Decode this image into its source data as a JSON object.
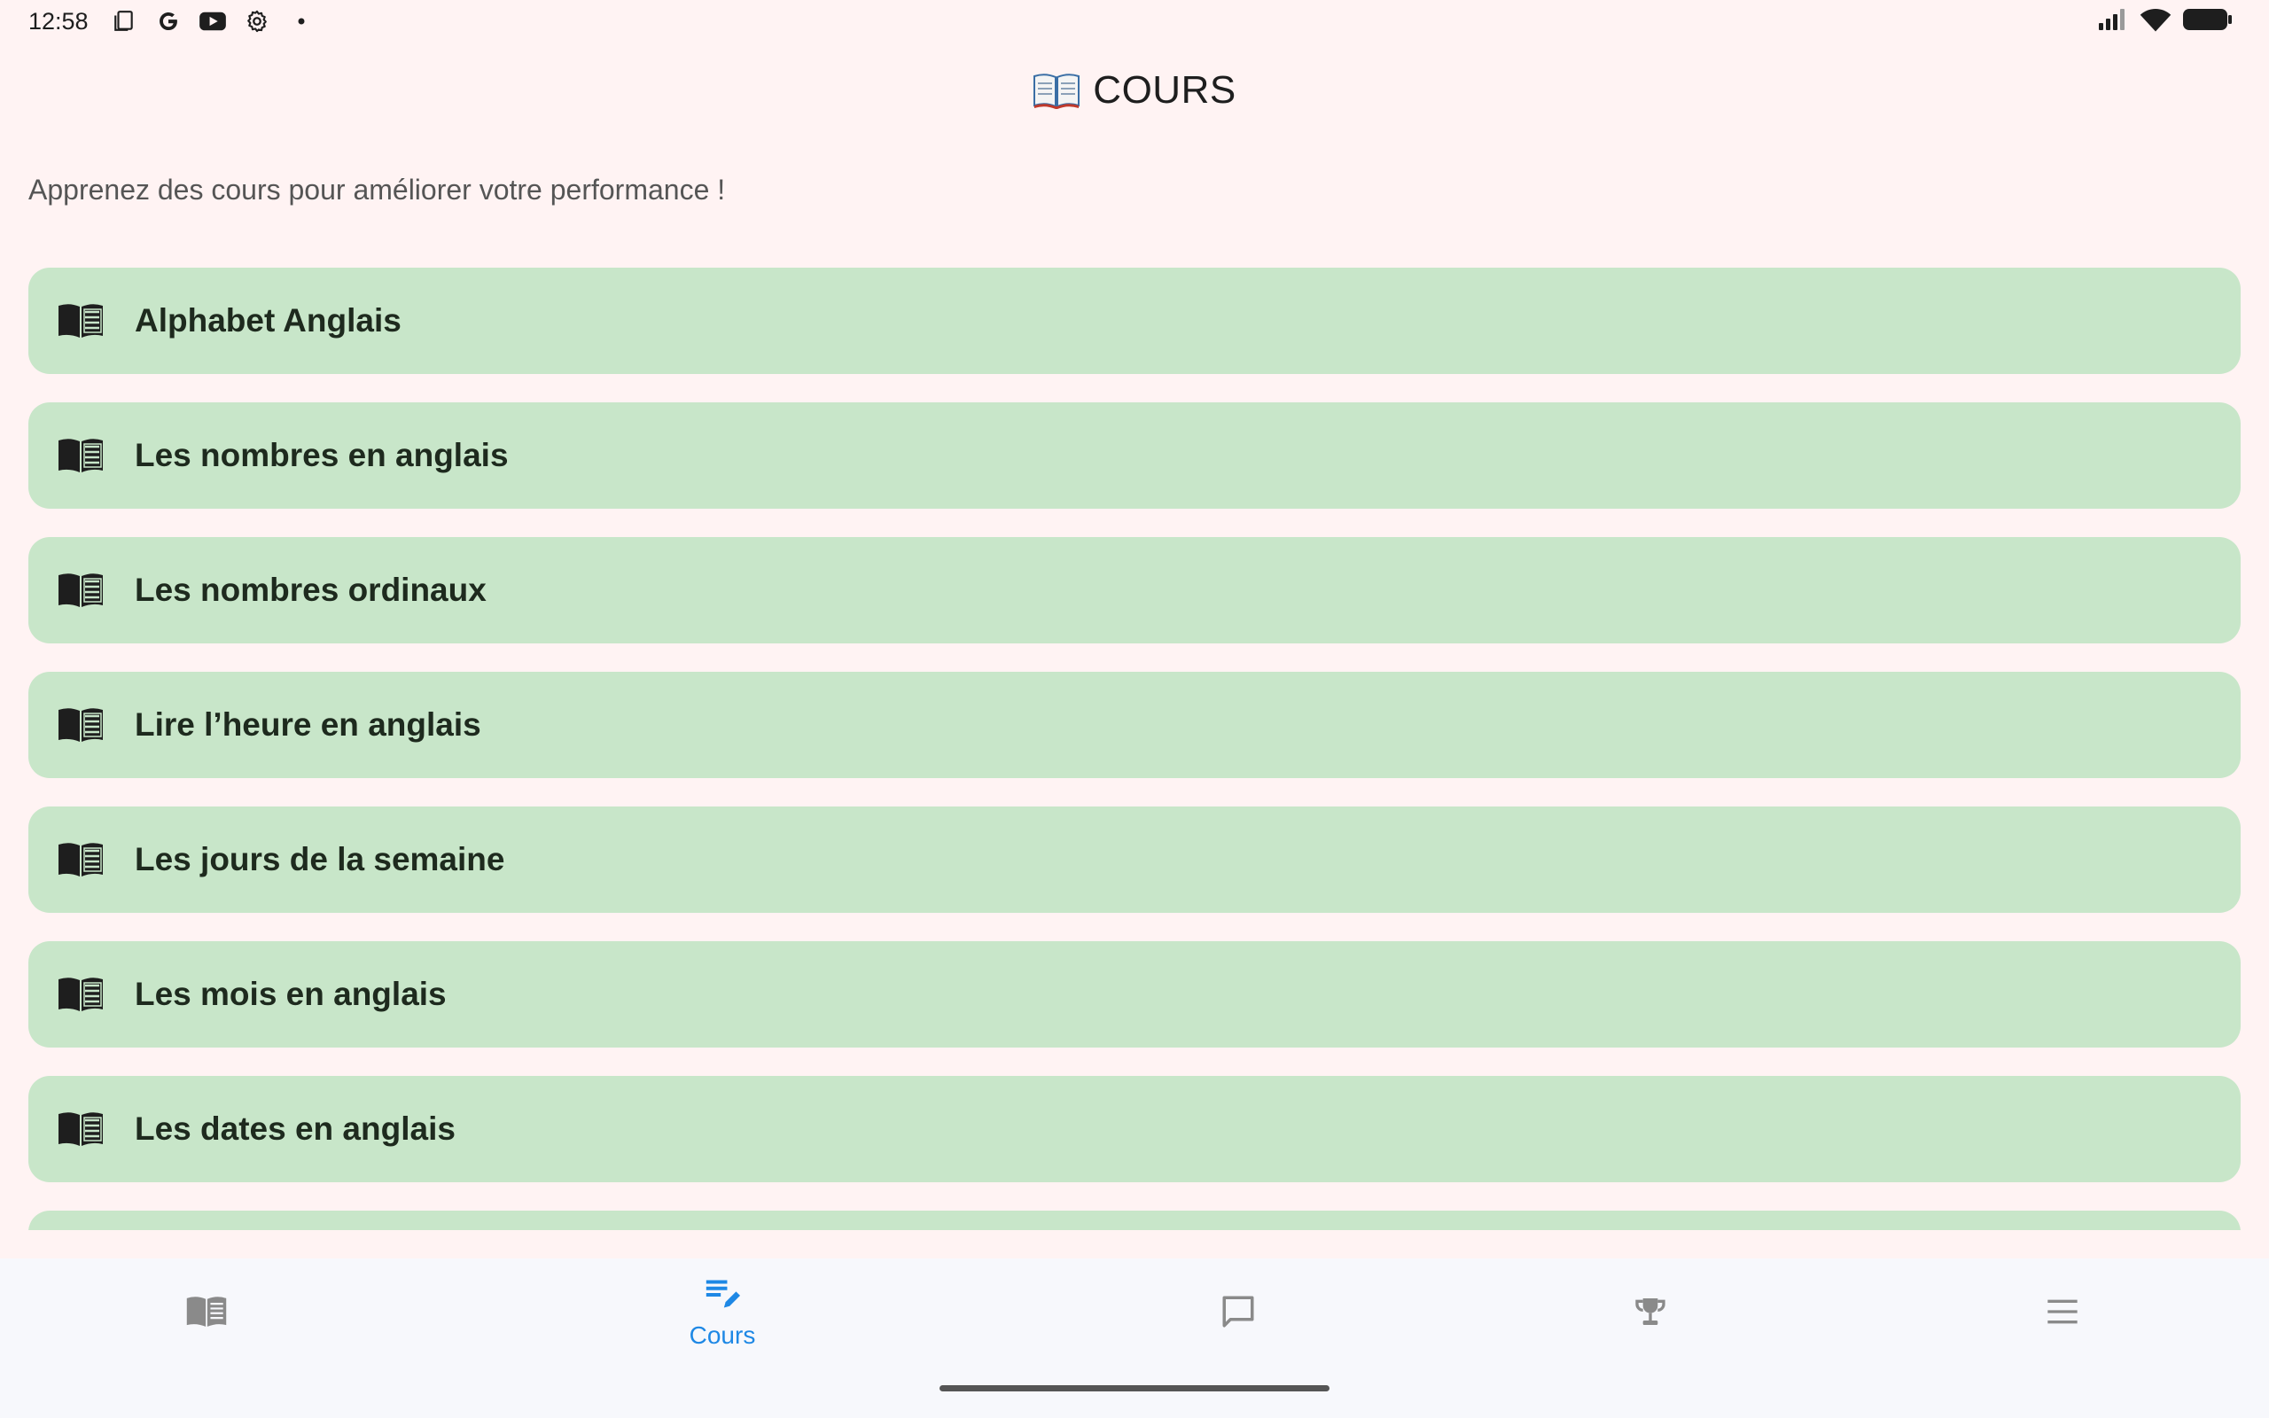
{
  "status_bar": {
    "time": "12:58",
    "left_icons": [
      "screen-icon",
      "google-icon",
      "youtube-icon",
      "settings-icon",
      "dot-icon"
    ],
    "right_icons": [
      "signal-icon",
      "wifi-icon",
      "battery-icon"
    ]
  },
  "header": {
    "title": "COURS",
    "title_icon": "open-book-icon"
  },
  "subtitle": "Apprenez des cours pour améliorer votre performance !",
  "courses": [
    {
      "label": "Alphabet Anglais",
      "icon": "menu-book-icon"
    },
    {
      "label": "Les nombres en anglais",
      "icon": "menu-book-icon"
    },
    {
      "label": "Les nombres ordinaux",
      "icon": "menu-book-icon"
    },
    {
      "label": "Lire l’heure en anglais",
      "icon": "menu-book-icon"
    },
    {
      "label": "Les jours de la semaine",
      "icon": "menu-book-icon"
    },
    {
      "label": "Les mois en anglais",
      "icon": "menu-book-icon"
    },
    {
      "label": "Les dates en anglais",
      "icon": "menu-book-icon"
    }
  ],
  "bottom_nav": {
    "items": [
      {
        "icon": "book-icon",
        "label": "",
        "active": false
      },
      {
        "icon": "edit-note-icon",
        "label": "Cours",
        "active": true
      },
      {
        "icon": "chat-icon",
        "label": "",
        "active": false
      },
      {
        "icon": "trophy-icon",
        "label": "",
        "active": false
      },
      {
        "icon": "menu-icon",
        "label": "",
        "active": false
      }
    ]
  },
  "colors": {
    "background": "#FFF3F3",
    "card": "#C8E6C9",
    "accent": "#1E88E5",
    "nav_background": "#F7F8FC",
    "inactive_icon": "#8A8A8A"
  }
}
